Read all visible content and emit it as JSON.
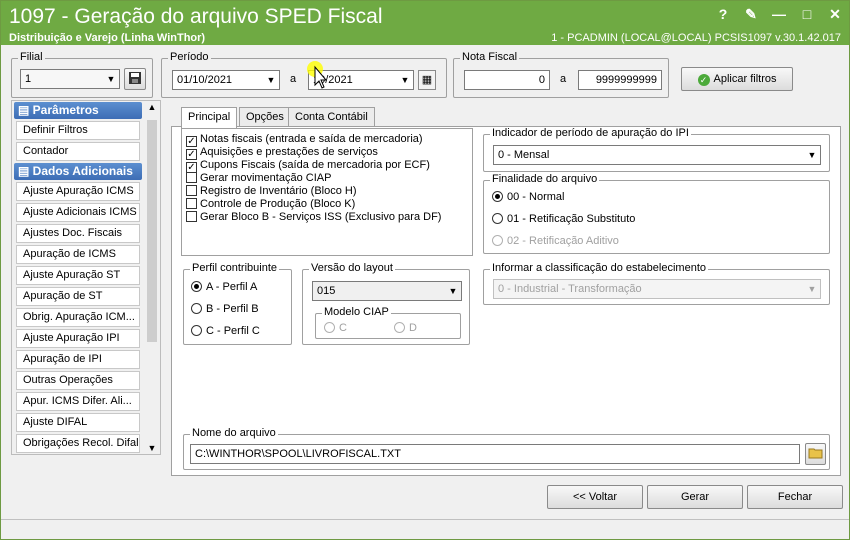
{
  "window": {
    "title": "1097 - Geração do arquivo SPED Fiscal",
    "subtitle": "Distribuição e Varejo (Linha WinThor)",
    "sysinfo": "1 - PCADMIN (LOCAL@LOCAL)   PCSIS1097   v.30.1.42.017",
    "help": "?",
    "minimize": "—",
    "restore": "□",
    "close": "✕"
  },
  "filial": {
    "label": "Filial",
    "value": "1"
  },
  "periodo": {
    "label": "Período",
    "from": "01/10/2021",
    "sep": "a",
    "to": "10/2021"
  },
  "nota_fiscal": {
    "label": "Nota Fiscal",
    "from": "0",
    "sep": "a",
    "to": "9999999999"
  },
  "apply_button": "Aplicar filtros",
  "sidebar": {
    "section1": "Parâmetros",
    "items1": [
      "Definir Filtros",
      "Contador"
    ],
    "section2": "Dados Adicionais",
    "items2": [
      "Ajuste Apuração ICMS",
      "Ajuste Adicionais ICMS",
      "Ajustes Doc. Fiscais",
      "Apuração de ICMS",
      "Ajuste Apuração ST",
      "Apuração de ST",
      "Obrig. Apuração ICM...",
      "Ajuste Apuração IPI",
      "Apuração de IPI",
      "Outras Operações",
      "Apur. ICMS Difer. Ali...",
      "Ajuste DIFAL",
      "Obrigações Recol. Difal"
    ]
  },
  "tabs": [
    "Principal",
    "Opções",
    "Conta Contábil"
  ],
  "checks": [
    {
      "label": "Notas fiscais (entrada e saída de mercadoria)",
      "checked": true
    },
    {
      "label": "Aquisições e prestações de serviços",
      "checked": true
    },
    {
      "label": "Cupons Fiscais (saída de mercadoria por ECF)",
      "checked": true
    },
    {
      "label": "Gerar movimentação CIAP",
      "checked": false
    },
    {
      "label": "Registro de Inventário (Bloco H)",
      "checked": false
    },
    {
      "label": "Controle de Produção (Bloco K)",
      "checked": false
    },
    {
      "label": "Gerar Bloco B - Serviços ISS (Exclusivo para DF)",
      "checked": false
    }
  ],
  "ipi": {
    "label": "Indicador de período de apuração do IPI",
    "value": "0 - Mensal"
  },
  "finalidade": {
    "label": "Finalidade do arquivo",
    "options": [
      "00 - Normal",
      "01 - Retificação Substituto",
      "02 - Retificação Aditivo"
    ]
  },
  "perfil": {
    "label": "Perfil contribuinte",
    "options": [
      "A - Perfil A",
      "B - Perfil B",
      "C - Perfil C"
    ]
  },
  "layout": {
    "label": "Versão do layout",
    "value": "015",
    "ciap_label": "Modelo CIAP",
    "ciap_c": "C",
    "ciap_d": "D"
  },
  "classificacao": {
    "label": "Informar a classificação do estabelecimento",
    "value": "0 - Industrial - Transformação"
  },
  "arquivo": {
    "label": "Nome do arquivo",
    "value": "C:\\WINTHOR\\SPOOL\\LIVROFISCAL.TXT"
  },
  "footer": {
    "back": "<< Voltar",
    "generate": "Gerar",
    "close": "Fechar"
  }
}
